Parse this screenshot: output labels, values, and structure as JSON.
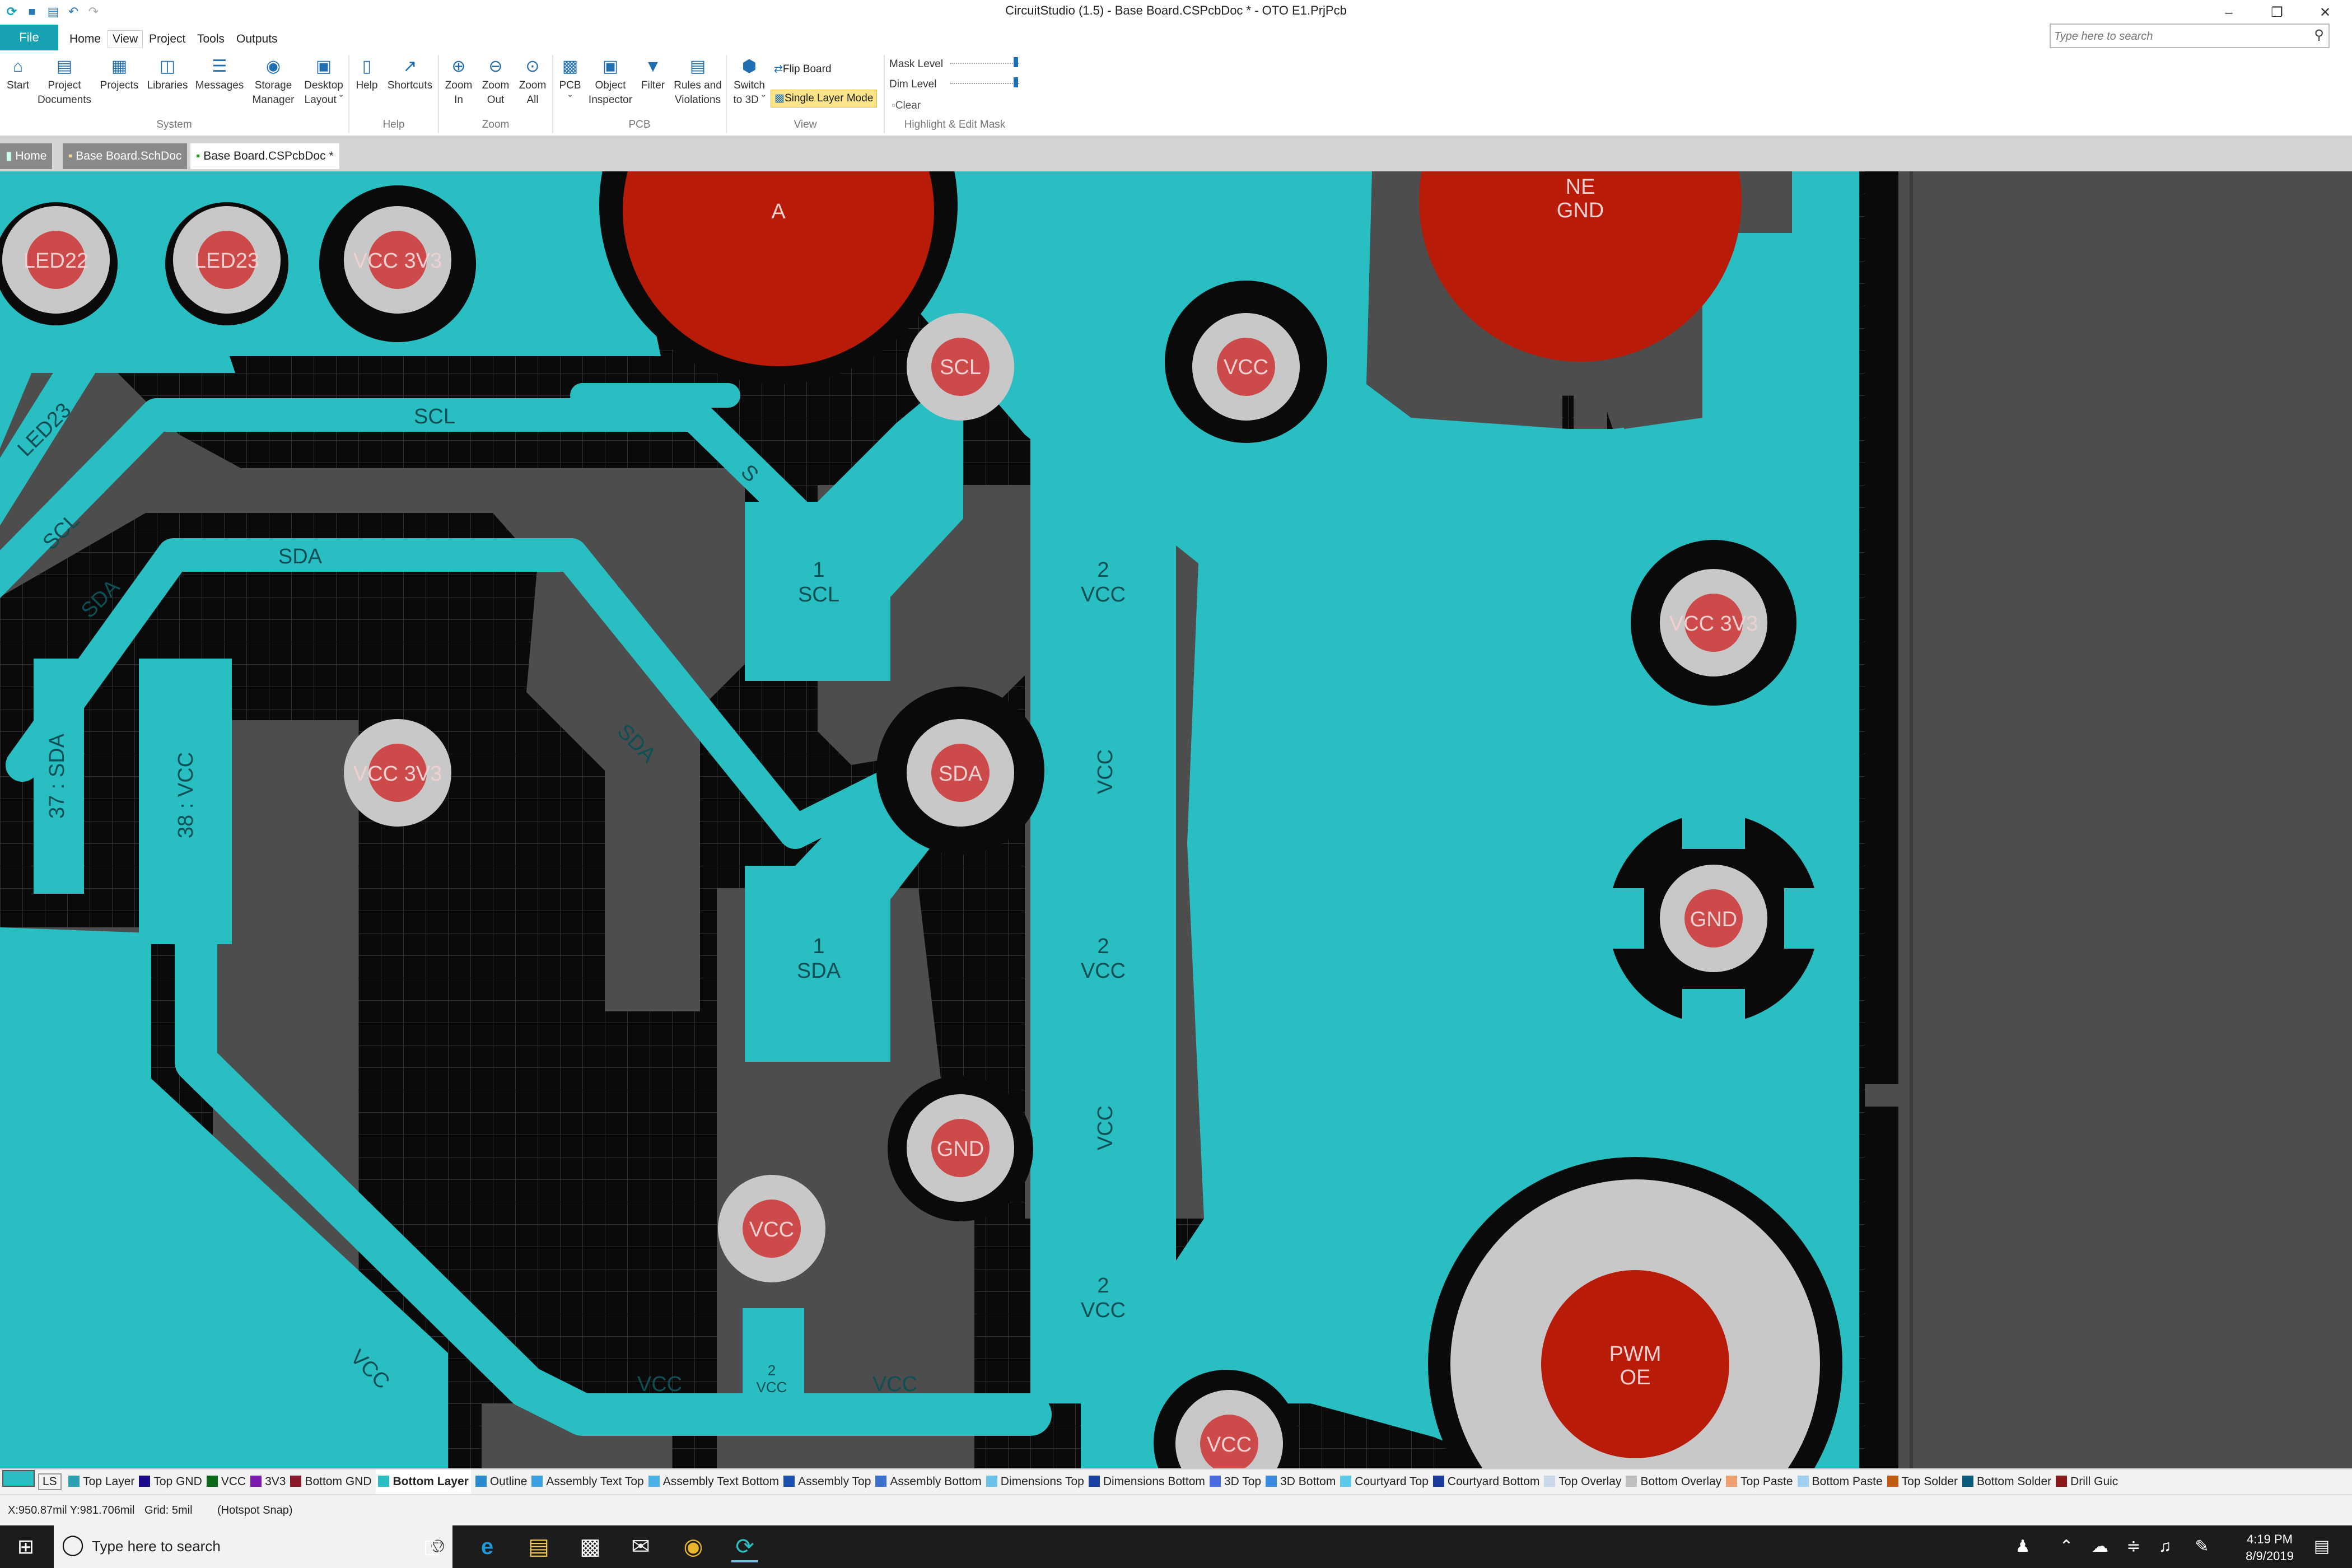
{
  "app": {
    "title": "CircuitStudio (1.5) - Base Board.CSPcbDoc * - OTO E1.PrjPcb",
    "search_placeholder": "Type here to search"
  },
  "menu": {
    "file": "File",
    "items": [
      "Home",
      "View",
      "Project",
      "Tools",
      "Outputs"
    ]
  },
  "ribbon": {
    "buttons": [
      {
        "l1": "Start",
        "l2": ""
      },
      {
        "l1": "Project",
        "l2": "Documents"
      },
      {
        "l1": "Projects",
        "l2": ""
      },
      {
        "l1": "Libraries",
        "l2": ""
      },
      {
        "l1": "Messages",
        "l2": ""
      },
      {
        "l1": "Storage",
        "l2": "Manager"
      },
      {
        "l1": "Desktop",
        "l2": "Layout ˇ"
      },
      {
        "l1": "Help",
        "l2": ""
      },
      {
        "l1": "Shortcuts",
        "l2": ""
      },
      {
        "l1": "Zoom",
        "l2": "In"
      },
      {
        "l1": "Zoom",
        "l2": "Out"
      },
      {
        "l1": "Zoom",
        "l2": "All"
      },
      {
        "l1": "PCB",
        "l2": "ˇ"
      },
      {
        "l1": "Object",
        "l2": "Inspector"
      },
      {
        "l1": "Filter",
        "l2": ""
      },
      {
        "l1": "Rules and",
        "l2": "Violations"
      },
      {
        "l1": "Switch",
        "l2": "to 3D ˇ"
      }
    ],
    "flip_board": "Flip Board",
    "single_layer_mode": "Single Layer Mode",
    "mask_level": "Mask Level",
    "dim_level": "Dim Level",
    "clear": "Clear",
    "groups": [
      "System",
      "Help",
      "Zoom",
      "PCB",
      "View",
      "Highlight & Edit Mask"
    ]
  },
  "doc_tabs": [
    "Home",
    "Base Board.SchDoc",
    "Base Board.CSPcbDoc *"
  ],
  "colors": {
    "copper": "#29bec1",
    "dark": "#4d4d4d",
    "black": "#0a0a0a",
    "pad_ring": "#c8c8c8",
    "pad_hole": "#cc4a4a",
    "big_pad": "#b81c08",
    "right_panel": "#4d4d4d",
    "text": "#0d4f55"
  },
  "pads": {
    "led22": "LED22",
    "led23": "LED23",
    "vcc3v3_top": "VCC 3V3",
    "scl": "SCL",
    "vcc_top": "VCC",
    "vcc3v3_right": "VCC 3V3",
    "vcc3v3_mid": "VCC 3V3",
    "sda": "SDA",
    "gnd_mid": "GND",
    "gnd_right": "GND",
    "vcc_bottom": "VCC",
    "vcc_bottom2": "VCC",
    "big_a": "A",
    "big_ne_1": "NE",
    "big_ne_2": "GND",
    "big_pwm_1": "PWM",
    "big_pwm_2": "OE"
  },
  "labels": {
    "led23": "LED23",
    "scl_track": "SCL",
    "scl_diag": "SCL",
    "sda_track": "SDA",
    "sda_diag": "SDA",
    "sda_long": "SDA",
    "sda_frag": "S",
    "pin37": "37 : SDA",
    "pin38": "38 : VCC",
    "pad1_num": "1",
    "pad1_net": "SCL",
    "pad2_num": "2",
    "pad2_net": "VCC",
    "vcc_v1": "VCC",
    "pad3_num": "1",
    "pad3_net": "SDA",
    "pad4_num": "2",
    "pad4_net": "VCC",
    "vcc_v2": "VCC",
    "pad5_num": "2",
    "pad5_net": "VCC",
    "vcc_diag": "VCC",
    "vcc_h1": "VCC",
    "vcc_h2": "VCC",
    "pad6_num": "2",
    "pad6_net": "VCC"
  },
  "layers": [
    {
      "name": "Top Layer",
      "color": "#2a9fb0"
    },
    {
      "name": "Top GND",
      "color": "#1a0a8a"
    },
    {
      "name": "VCC",
      "color": "#0a6a1a"
    },
    {
      "name": "3V3",
      "color": "#7a1ab0"
    },
    {
      "name": "Bottom GND",
      "color": "#8a1a2a"
    },
    {
      "name": "Bottom Layer",
      "color": "#29bec1"
    },
    {
      "name": "Outline",
      "color": "#2a8ad0"
    },
    {
      "name": "Assembly Text Top",
      "color": "#3aa0e0"
    },
    {
      "name": "Assembly Text Bottom",
      "color": "#4ab0e8"
    },
    {
      "name": "Assembly Top",
      "color": "#1a50b0"
    },
    {
      "name": "Assembly Bottom",
      "color": "#3a70d0"
    },
    {
      "name": "Dimensions Top",
      "color": "#6ac0e8"
    },
    {
      "name": "Dimensions Bottom",
      "color": "#1a40a0"
    },
    {
      "name": "3D Top",
      "color": "#4a6ae0"
    },
    {
      "name": "3D Bottom",
      "color": "#3a8ae0"
    },
    {
      "name": "Courtyard Top",
      "color": "#5ac8e8"
    },
    {
      "name": "Courtyard Bottom",
      "color": "#1a3aa0"
    },
    {
      "name": "Top Overlay",
      "color": "#c8d8e8"
    },
    {
      "name": "Bottom Overlay",
      "color": "#c0c0c0"
    },
    {
      "name": "Top Paste",
      "color": "#f0a070"
    },
    {
      "name": "Bottom Paste",
      "color": "#a0d0f0"
    },
    {
      "name": "Top Solder",
      "color": "#c05a10"
    },
    {
      "name": "Bottom Solder",
      "color": "#0a5a7a"
    },
    {
      "name": "Drill Guic",
      "color": "#8a1a1a"
    }
  ],
  "layer_ls": "LS",
  "status": {
    "coords": "X:950.87mil Y:981.706mil",
    "grid": "Grid: 5mil",
    "snap": "(Hotspot Snap)"
  },
  "taskbar": {
    "search": "Type here to search",
    "time": "4:19 PM",
    "date": "8/9/2019"
  }
}
